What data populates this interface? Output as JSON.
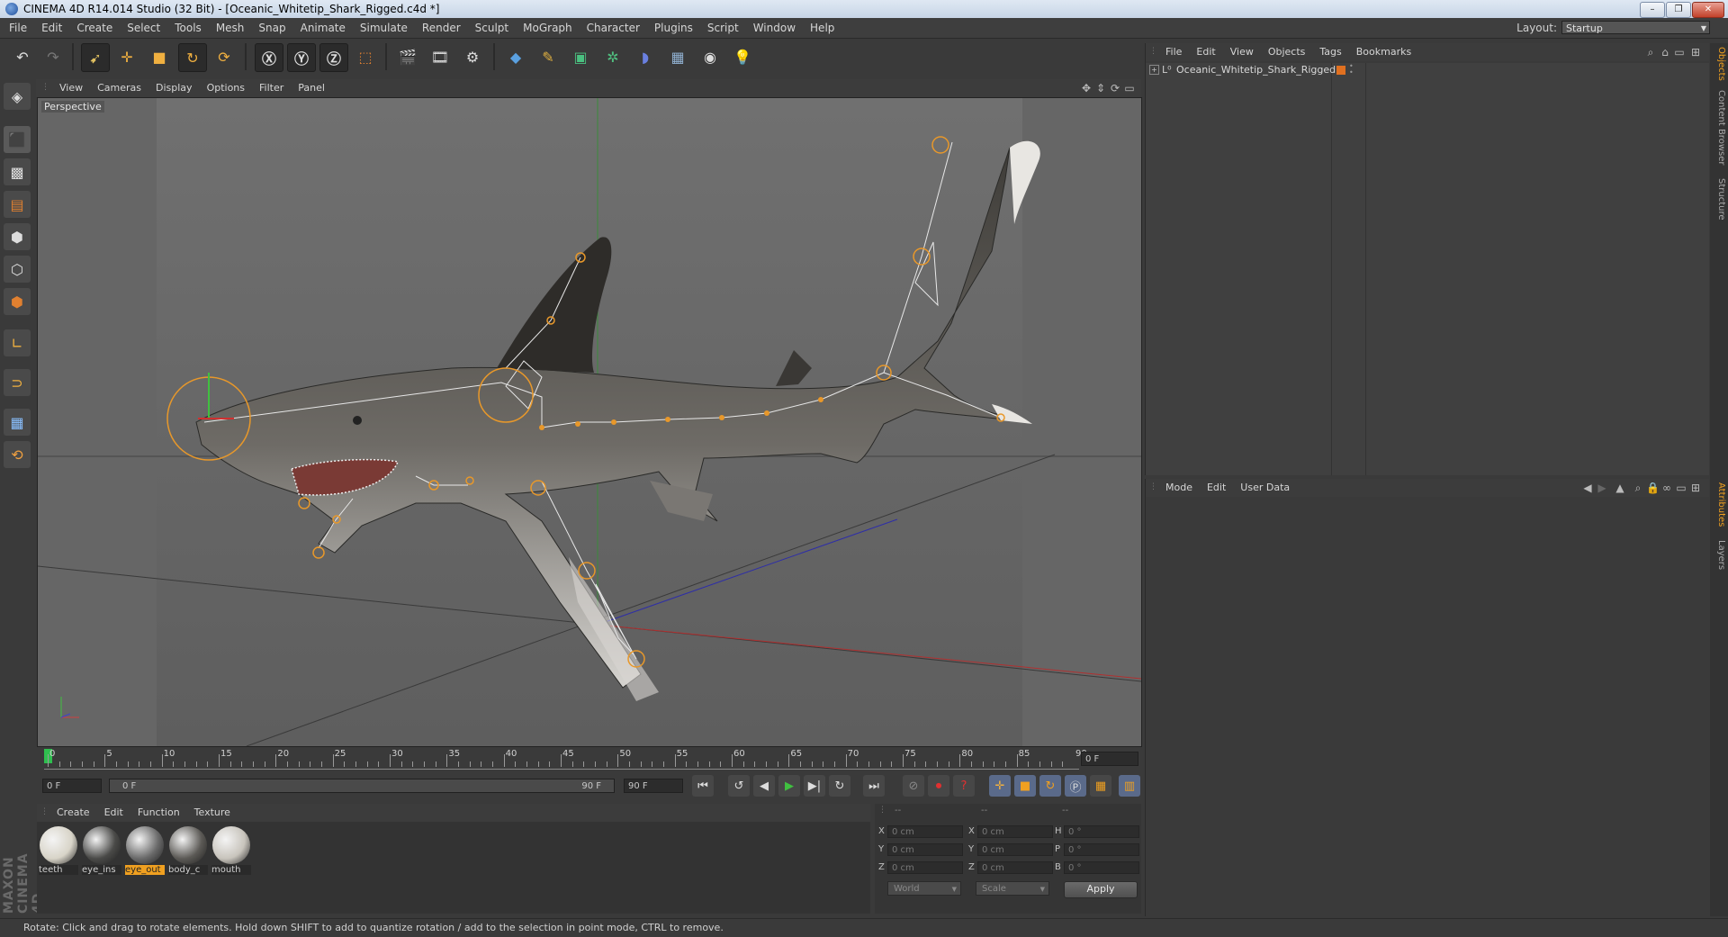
{
  "titlebar": {
    "title": "CINEMA 4D R14.014 Studio (32 Bit) - [Oceanic_Whitetip_Shark_Rigged.c4d *]"
  },
  "menubar": {
    "items": [
      "File",
      "Edit",
      "Create",
      "Select",
      "Tools",
      "Mesh",
      "Snap",
      "Animate",
      "Simulate",
      "Render",
      "Sculpt",
      "MoGraph",
      "Character",
      "Plugins",
      "Script",
      "Window",
      "Help"
    ],
    "layout_label": "Layout:",
    "layout_value": "Startup"
  },
  "viewport": {
    "menu": [
      "View",
      "Cameras",
      "Display",
      "Options",
      "Filter",
      "Panel"
    ],
    "camera_label": "Perspective"
  },
  "timeline": {
    "ticks": [
      "0",
      "5",
      "10",
      "15",
      "20",
      "25",
      "30",
      "35",
      "40",
      "45",
      "50",
      "55",
      "60",
      "65",
      "70",
      "75",
      "80",
      "85",
      "90"
    ],
    "current_frame": "0 F"
  },
  "transport": {
    "start_field": "0 F",
    "range_start": "0 F",
    "range_end": "90 F",
    "end_field": "90 F"
  },
  "materials": {
    "menu": [
      "Create",
      "Edit",
      "Function",
      "Texture"
    ],
    "items": [
      {
        "name": "teeth",
        "selected": false,
        "color": "#d8d4c8"
      },
      {
        "name": "eye_ins",
        "selected": false,
        "color": "#4a4a48"
      },
      {
        "name": "eye_out",
        "selected": true,
        "color": "#6a6a6a"
      },
      {
        "name": "body_c",
        "selected": false,
        "color": "#5c5a56"
      },
      {
        "name": "mouth",
        "selected": false,
        "color": "#c8c4bc"
      }
    ]
  },
  "coords": {
    "col_headers": [
      "--",
      "--",
      "--"
    ],
    "rows": [
      {
        "a": "X",
        "av": "0 cm",
        "b": "X",
        "bv": "0 cm",
        "c": "H",
        "cv": "0 °"
      },
      {
        "a": "Y",
        "av": "0 cm",
        "b": "Y",
        "bv": "0 cm",
        "c": "P",
        "cv": "0 °"
      },
      {
        "a": "Z",
        "av": "0 cm",
        "b": "Z",
        "bv": "0 cm",
        "c": "B",
        "cv": "0 °"
      }
    ],
    "space_select": "World",
    "mode_select": "Scale",
    "apply_label": "Apply"
  },
  "object_manager": {
    "menu": [
      "File",
      "Edit",
      "View",
      "Objects",
      "Tags",
      "Bookmarks"
    ],
    "objects": [
      {
        "name": "Oceanic_Whitetip_Shark_Rigged"
      }
    ]
  },
  "attribute_manager": {
    "menu": [
      "Mode",
      "Edit",
      "User Data"
    ]
  },
  "right_tabs": [
    "Objects",
    "Content Browser",
    "Structure",
    "Attributes",
    "Layers"
  ],
  "status": {
    "text": "Rotate: Click and drag to rotate elements. Hold down SHIFT to add to quantize rotation / add to the selection in point mode, CTRL to remove."
  },
  "brand": {
    "text": "MAXON CINEMA 4D"
  },
  "colors": {
    "accent": "#f0a020",
    "selection_ring": "#e8982a"
  }
}
